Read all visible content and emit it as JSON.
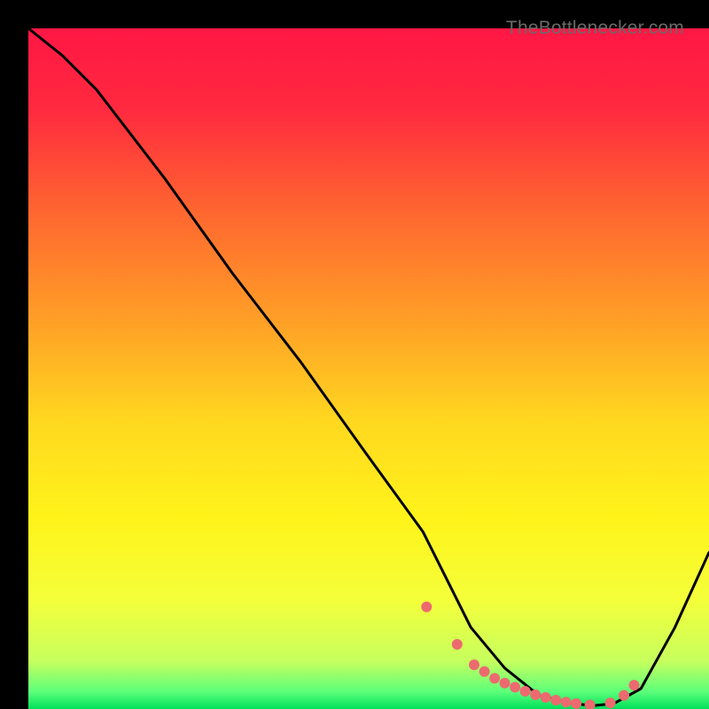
{
  "watermark": "TheBottlenecker.com",
  "chart_data": {
    "type": "line",
    "title": "",
    "xlabel": "",
    "ylabel": "",
    "xlim": [
      0,
      100
    ],
    "ylim": [
      0,
      100
    ],
    "series": [
      {
        "name": "curve",
        "x": [
          0,
          5,
          10,
          20,
          30,
          40,
          50,
          58,
          62,
          65,
          70,
          75,
          80,
          83,
          86,
          90,
          95,
          100
        ],
        "y": [
          100,
          96,
          91,
          78,
          64,
          51,
          37,
          26,
          18,
          12,
          6,
          2,
          0.8,
          0.5,
          0.8,
          3,
          12,
          23
        ]
      }
    ],
    "markers": {
      "x": [
        58.5,
        63,
        65.5,
        67,
        68.5,
        70,
        71.5,
        73,
        74.5,
        76,
        77.5,
        79,
        80.5,
        82.5,
        85.5,
        87.5,
        89
      ],
      "y": [
        15,
        9.5,
        6.5,
        5.5,
        4.5,
        3.8,
        3.2,
        2.6,
        2.1,
        1.7,
        1.3,
        1.0,
        0.8,
        0.6,
        0.9,
        2.0,
        3.5
      ]
    },
    "gradient_stops": [
      {
        "offset": 0.0,
        "color": "#ff1744"
      },
      {
        "offset": 0.12,
        "color": "#ff2a3f"
      },
      {
        "offset": 0.28,
        "color": "#ff6a2f"
      },
      {
        "offset": 0.44,
        "color": "#ffa326"
      },
      {
        "offset": 0.58,
        "color": "#ffd91f"
      },
      {
        "offset": 0.72,
        "color": "#fff31a"
      },
      {
        "offset": 0.84,
        "color": "#f4ff3a"
      },
      {
        "offset": 0.93,
        "color": "#c6ff5e"
      },
      {
        "offset": 0.975,
        "color": "#5bff7a"
      },
      {
        "offset": 1.0,
        "color": "#00e05a"
      }
    ],
    "marker_color": "#ec6a6f",
    "line_color": "#000000"
  }
}
